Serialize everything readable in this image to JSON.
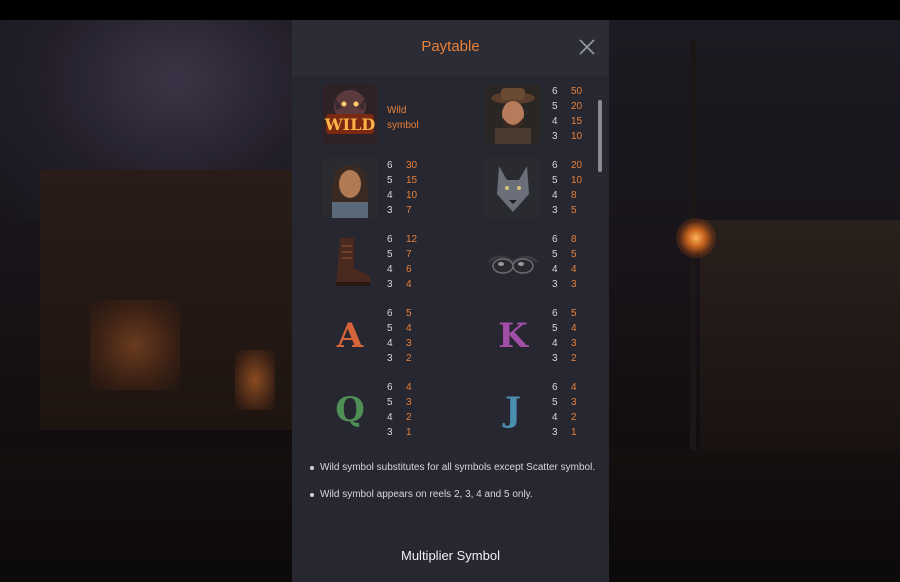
{
  "panel": {
    "title": "Paytable",
    "section_title": "Multiplier Symbol"
  },
  "symbols": {
    "wild": {
      "label": "Wild symbol",
      "badge": "WILD"
    },
    "cowboy": {
      "pays": [
        [
          "6",
          "50"
        ],
        [
          "5",
          "20"
        ],
        [
          "4",
          "15"
        ],
        [
          "3",
          "10"
        ]
      ]
    },
    "woman": {
      "pays": [
        [
          "6",
          "30"
        ],
        [
          "5",
          "15"
        ],
        [
          "4",
          "10"
        ],
        [
          "3",
          "7"
        ]
      ]
    },
    "wolf": {
      "pays": [
        [
          "6",
          "20"
        ],
        [
          "5",
          "10"
        ],
        [
          "4",
          "8"
        ],
        [
          "3",
          "5"
        ]
      ]
    },
    "boot": {
      "pays": [
        [
          "6",
          "12"
        ],
        [
          "5",
          "7"
        ],
        [
          "4",
          "6"
        ],
        [
          "3",
          "4"
        ]
      ]
    },
    "goggles": {
      "pays": [
        [
          "6",
          "8"
        ],
        [
          "5",
          "5"
        ],
        [
          "4",
          "4"
        ],
        [
          "3",
          "3"
        ]
      ]
    },
    "A": {
      "letter": "A",
      "color": "#d5643a",
      "pays": [
        [
          "6",
          "5"
        ],
        [
          "5",
          "4"
        ],
        [
          "4",
          "3"
        ],
        [
          "3",
          "2"
        ]
      ]
    },
    "K": {
      "letter": "K",
      "color": "#a14fa6",
      "pays": [
        [
          "6",
          "5"
        ],
        [
          "5",
          "4"
        ],
        [
          "4",
          "3"
        ],
        [
          "3",
          "2"
        ]
      ]
    },
    "Q": {
      "letter": "Q",
      "color": "#4f8e55",
      "pays": [
        [
          "6",
          "4"
        ],
        [
          "5",
          "3"
        ],
        [
          "4",
          "2"
        ],
        [
          "3",
          "1"
        ]
      ]
    },
    "J": {
      "letter": "J",
      "color": "#4b8fb0",
      "pays": [
        [
          "6",
          "4"
        ],
        [
          "5",
          "3"
        ],
        [
          "4",
          "2"
        ],
        [
          "3",
          "1"
        ]
      ]
    }
  },
  "rules": [
    "Wild symbol substitutes for all symbols except Scatter symbol.",
    "Wild symbol appears on reels 2, 3, 4 and 5 only."
  ],
  "icons": [
    "close-icon",
    "wild-symbol-icon",
    "cowboy-symbol-icon",
    "woman-symbol-icon",
    "wolf-symbol-icon",
    "boot-symbol-icon",
    "goggles-symbol-icon"
  ],
  "colors": {
    "accent": "#e9813a",
    "panel_bg": "#262730",
    "text": "#d6d6da"
  }
}
